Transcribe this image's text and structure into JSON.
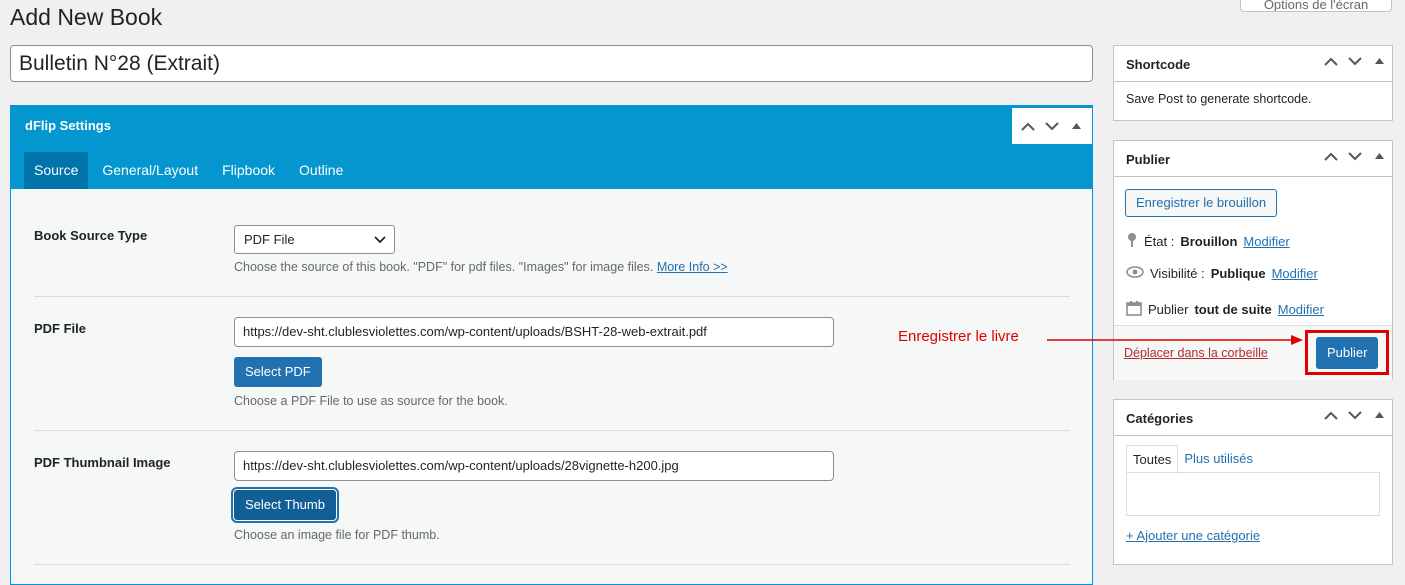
{
  "page": {
    "title": "Add New Book",
    "screen_options_label": "Options de l'écran",
    "post_title_value": "Bulletin N°28 (Extrait)"
  },
  "dflip": {
    "title": "dFlip Settings",
    "tabs": [
      {
        "label": "Source"
      },
      {
        "label": "General/Layout"
      },
      {
        "label": "Flipbook"
      },
      {
        "label": "Outline"
      }
    ],
    "source_type": {
      "label": "Book Source Type",
      "selected": "PDF File",
      "description": "Choose the source of this book. \"PDF\" for pdf files. \"Images\" for image files.",
      "more_info": "More Info >>"
    },
    "pdf_file": {
      "label": "PDF File",
      "value": "https://dev-sht.clublesviolettes.com/wp-content/uploads/BSHT-28-web-extrait.pdf",
      "button": "Select PDF",
      "description": "Choose a PDF File to use as source for the book."
    },
    "pdf_thumb": {
      "label": "PDF Thumbnail Image",
      "value": "https://dev-sht.clublesviolettes.com/wp-content/uploads/28vignette-h200.jpg",
      "button": "Select Thumb",
      "description": "Choose an image file for PDF thumb."
    }
  },
  "shortcode": {
    "title": "Shortcode",
    "text": "Save Post to generate shortcode."
  },
  "publish": {
    "title": "Publier",
    "save_draft": "Enregistrer le brouillon",
    "status_label": "État :",
    "status_value": "Brouillon",
    "visibility_label": "Visibilité :",
    "visibility_value": "Publique",
    "schedule_label": "Publier",
    "schedule_value": "tout de suite",
    "edit_link": "Modifier",
    "trash": "Déplacer dans la corbeille",
    "publish_button": "Publier"
  },
  "annotation": {
    "text": "Enregistrer le livre",
    "color": "#e00000"
  },
  "categories": {
    "title": "Catégories",
    "tab_all": "Toutes",
    "tab_popular": "Plus utilisés",
    "add_link": "+ Ajouter une catégorie"
  },
  "colors": {
    "accent": "#2271b1",
    "dflip_header": "#0396cf"
  }
}
